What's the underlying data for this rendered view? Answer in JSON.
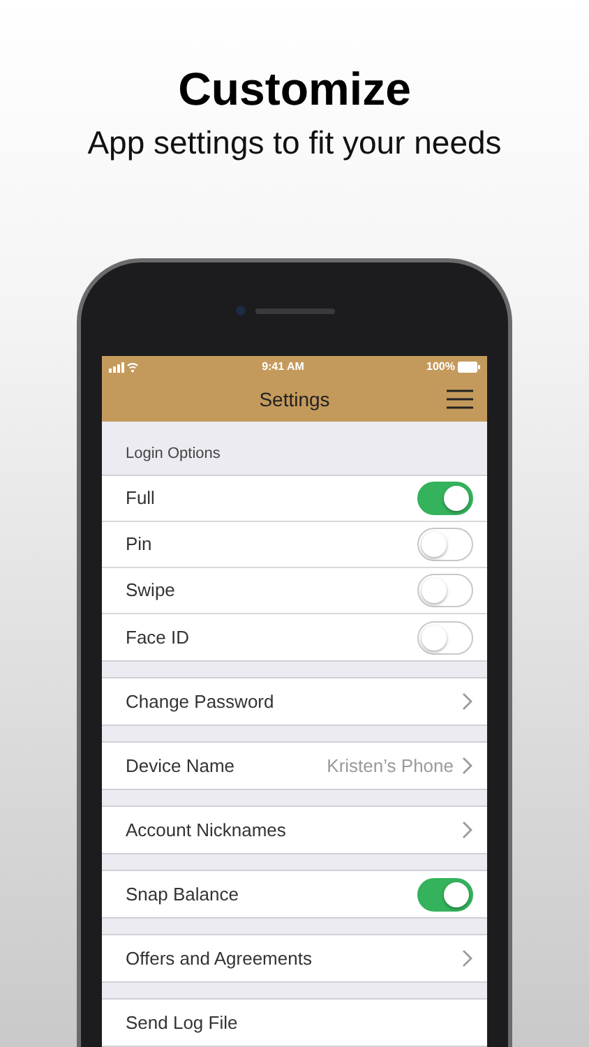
{
  "promo": {
    "title": "Customize",
    "subtitle": "App settings to fit your needs"
  },
  "status_bar": {
    "time": "9:41 AM",
    "battery": "100%"
  },
  "header": {
    "title": "Settings"
  },
  "section_title": "Login Options",
  "groups": [
    {
      "items": [
        {
          "kind": "toggle",
          "label": "Full",
          "on": true
        },
        {
          "kind": "toggle",
          "label": "Pin",
          "on": false
        },
        {
          "kind": "toggle",
          "label": "Swipe",
          "on": false
        },
        {
          "kind": "toggle",
          "label": "Face ID",
          "on": false
        }
      ]
    },
    {
      "items": [
        {
          "kind": "link",
          "label": "Change Password"
        }
      ]
    },
    {
      "items": [
        {
          "kind": "link",
          "label": "Device Name",
          "value": "Kristen’s Phone"
        }
      ]
    },
    {
      "items": [
        {
          "kind": "link",
          "label": "Account Nicknames"
        }
      ]
    },
    {
      "items": [
        {
          "kind": "toggle",
          "label": "Snap Balance",
          "on": true
        }
      ]
    },
    {
      "items": [
        {
          "kind": "link",
          "label": "Offers and Agreements"
        }
      ]
    },
    {
      "items": [
        {
          "kind": "action",
          "label": "Send Log File"
        }
      ]
    }
  ]
}
